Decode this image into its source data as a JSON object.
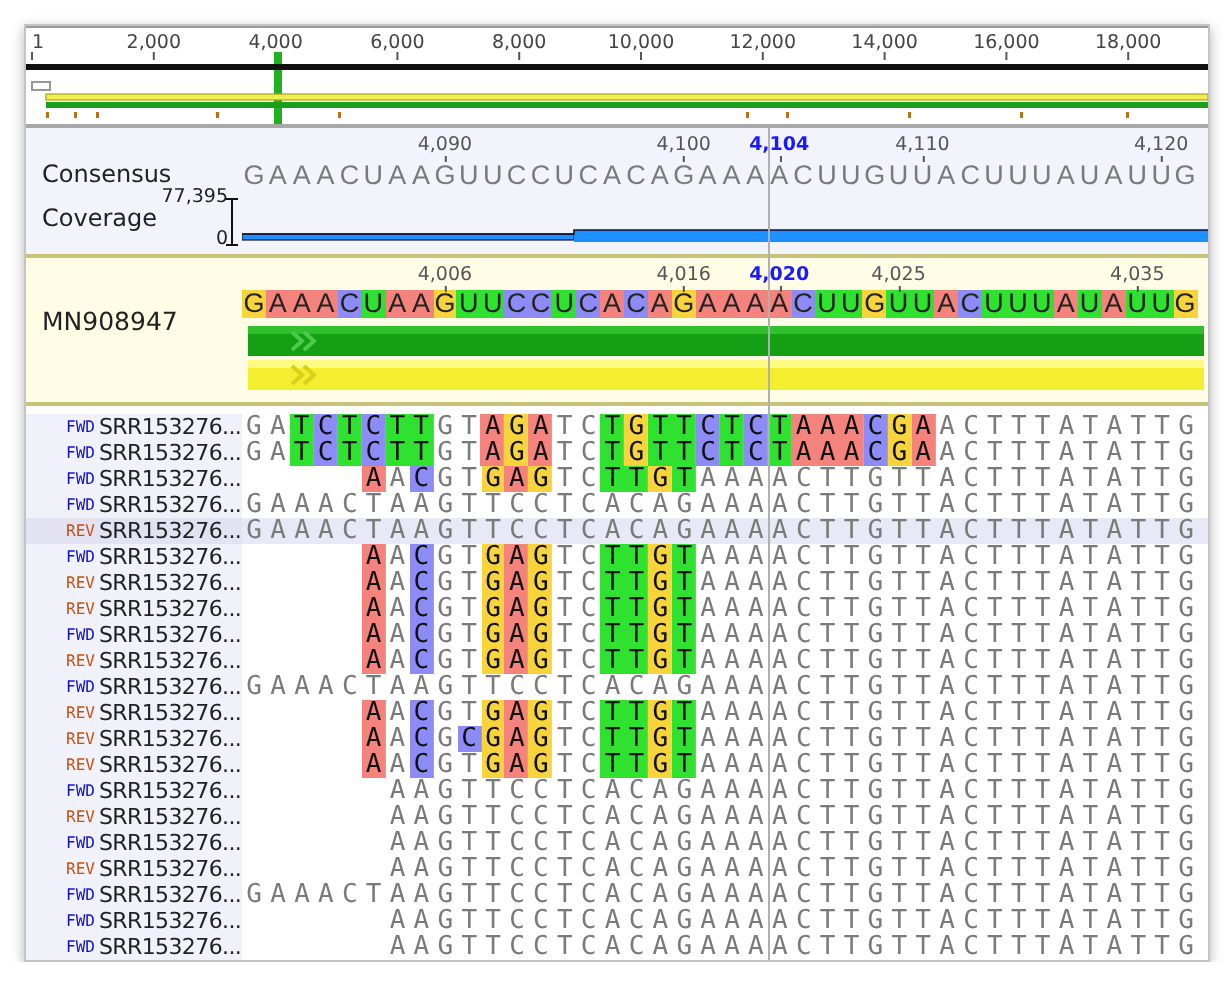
{
  "overview": {
    "ticks": [
      "1",
      "2,000",
      "4,000",
      "6,000",
      "8,000",
      "10,000",
      "12,000",
      "14,000",
      "16,000",
      "18,000"
    ]
  },
  "consensus": {
    "label": "Consensus",
    "columns": [
      {
        "base": "G"
      },
      {
        "base": "A"
      },
      {
        "base": "A"
      },
      {
        "base": "A"
      },
      {
        "base": "C"
      },
      {
        "base": "U"
      },
      {
        "base": "A"
      },
      {
        "base": "A"
      },
      {
        "base": "G",
        "tick": "4,090",
        "current": false
      },
      {
        "base": "U"
      },
      {
        "base": "U"
      },
      {
        "base": "C"
      },
      {
        "base": "C"
      },
      {
        "base": "U"
      },
      {
        "base": "C"
      },
      {
        "base": "A"
      },
      {
        "base": "C"
      },
      {
        "base": "A"
      },
      {
        "base": "G",
        "tick": "4,100",
        "current": false
      },
      {
        "base": "A"
      },
      {
        "base": "A"
      },
      {
        "base": "A"
      },
      {
        "base": "A",
        "tick": "4,104",
        "current": true
      },
      {
        "base": "C"
      },
      {
        "base": "U"
      },
      {
        "base": "U"
      },
      {
        "base": "G"
      },
      {
        "base": "U"
      },
      {
        "base": "U",
        "tick": "4,110",
        "current": false
      },
      {
        "base": "A"
      },
      {
        "base": "C"
      },
      {
        "base": "U"
      },
      {
        "base": "U"
      },
      {
        "base": "U"
      },
      {
        "base": "A"
      },
      {
        "base": "U"
      },
      {
        "base": "A"
      },
      {
        "base": "U"
      },
      {
        "base": "U",
        "tick": "4,120",
        "current": false
      },
      {
        "base": "G"
      }
    ]
  },
  "coverage": {
    "label": "Coverage",
    "max": "77,395",
    "min": "0"
  },
  "reference": {
    "name": "MN908947",
    "columns": [
      {
        "base": "G",
        "color": "#f7d33c"
      },
      {
        "base": "A",
        "color": "#f4837d"
      },
      {
        "base": "A",
        "color": "#f4837d"
      },
      {
        "base": "A",
        "color": "#f4837d"
      },
      {
        "base": "C",
        "color": "#8d8cf7"
      },
      {
        "base": "U",
        "color": "#2fe22f"
      },
      {
        "base": "A",
        "color": "#f4837d"
      },
      {
        "base": "A",
        "color": "#f4837d"
      },
      {
        "base": "G",
        "color": "#f7d33c",
        "tick": "4,006",
        "current": false
      },
      {
        "base": "U",
        "color": "#2fe22f"
      },
      {
        "base": "U",
        "color": "#2fe22f"
      },
      {
        "base": "C",
        "color": "#8d8cf7"
      },
      {
        "base": "C",
        "color": "#8d8cf7"
      },
      {
        "base": "U",
        "color": "#2fe22f"
      },
      {
        "base": "C",
        "color": "#8d8cf7"
      },
      {
        "base": "A",
        "color": "#f4837d"
      },
      {
        "base": "C",
        "color": "#8d8cf7"
      },
      {
        "base": "A",
        "color": "#f4837d"
      },
      {
        "base": "G",
        "color": "#f7d33c",
        "tick": "4,016",
        "current": false
      },
      {
        "base": "A",
        "color": "#f4837d"
      },
      {
        "base": "A",
        "color": "#f4837d"
      },
      {
        "base": "A",
        "color": "#f4837d"
      },
      {
        "base": "A",
        "color": "#f4837d",
        "tick": "4,020",
        "current": true
      },
      {
        "base": "C",
        "color": "#8d8cf7"
      },
      {
        "base": "U",
        "color": "#2fe22f"
      },
      {
        "base": "U",
        "color": "#2fe22f"
      },
      {
        "base": "G",
        "color": "#f7d33c"
      },
      {
        "base": "U",
        "color": "#2fe22f",
        "tick": "4,025",
        "current": false
      },
      {
        "base": "U",
        "color": "#2fe22f"
      },
      {
        "base": "A",
        "color": "#f4837d"
      },
      {
        "base": "C",
        "color": "#8d8cf7"
      },
      {
        "base": "U",
        "color": "#2fe22f"
      },
      {
        "base": "U",
        "color": "#2fe22f"
      },
      {
        "base": "U",
        "color": "#2fe22f"
      },
      {
        "base": "A",
        "color": "#f4837d"
      },
      {
        "base": "U",
        "color": "#2fe22f"
      },
      {
        "base": "A",
        "color": "#f4837d"
      },
      {
        "base": "U",
        "color": "#2fe22f",
        "tick": "4,035",
        "current": false
      },
      {
        "base": "U",
        "color": "#2fe22f"
      },
      {
        "base": "G",
        "color": "#f7d33c"
      }
    ]
  },
  "reads": [
    {
      "strand": "FWD",
      "kind": "fwd",
      "name": "SRR153276...",
      "selected": false,
      "runs": [
        {
          "text": "GA"
        },
        {
          "text": "T",
          "color": "#2fe22f"
        },
        {
          "text": "C",
          "color": "#8d8cf7"
        },
        {
          "text": "T",
          "color": "#2fe22f"
        },
        {
          "text": "C",
          "color": "#8d8cf7"
        },
        {
          "text": "TT",
          "color": "#2fe22f"
        },
        {
          "text": "GT"
        },
        {
          "text": "A",
          "color": "#f4837d"
        },
        {
          "text": "G",
          "color": "#f7d33c"
        },
        {
          "text": "A",
          "color": "#f4837d"
        },
        {
          "text": "TC"
        },
        {
          "text": "T",
          "color": "#2fe22f"
        },
        {
          "text": "G",
          "color": "#f7d33c"
        },
        {
          "text": "TT",
          "color": "#2fe22f"
        },
        {
          "text": "C",
          "color": "#8d8cf7"
        },
        {
          "text": "T",
          "color": "#2fe22f"
        },
        {
          "text": "C",
          "color": "#8d8cf7"
        },
        {
          "text": "T",
          "color": "#2fe22f"
        },
        {
          "text": "AAA",
          "color": "#f4837d"
        },
        {
          "text": "C",
          "color": "#8d8cf7"
        },
        {
          "text": "G",
          "color": "#f7d33c"
        },
        {
          "text": "A",
          "color": "#f4837d"
        },
        {
          "text": "ACTTTATATTG"
        }
      ]
    },
    {
      "strand": "FWD",
      "kind": "fwd",
      "name": "SRR153276...",
      "selected": false,
      "runs": [
        {
          "text": "GA"
        },
        {
          "text": "T",
          "color": "#2fe22f"
        },
        {
          "text": "C",
          "color": "#8d8cf7"
        },
        {
          "text": "T",
          "color": "#2fe22f"
        },
        {
          "text": "C",
          "color": "#8d8cf7"
        },
        {
          "text": "TT",
          "color": "#2fe22f"
        },
        {
          "text": "GT"
        },
        {
          "text": "A",
          "color": "#f4837d"
        },
        {
          "text": "G",
          "color": "#f7d33c"
        },
        {
          "text": "A",
          "color": "#f4837d"
        },
        {
          "text": "TC"
        },
        {
          "text": "T",
          "color": "#2fe22f"
        },
        {
          "text": "G",
          "color": "#f7d33c"
        },
        {
          "text": "TT",
          "color": "#2fe22f"
        },
        {
          "text": "C",
          "color": "#8d8cf7"
        },
        {
          "text": "T",
          "color": "#2fe22f"
        },
        {
          "text": "C",
          "color": "#8d8cf7"
        },
        {
          "text": "T",
          "color": "#2fe22f"
        },
        {
          "text": "AAA",
          "color": "#f4837d"
        },
        {
          "text": "C",
          "color": "#8d8cf7"
        },
        {
          "text": "G",
          "color": "#f7d33c"
        },
        {
          "text": "A",
          "color": "#f4837d"
        },
        {
          "text": "ACTTTATATTG"
        }
      ]
    },
    {
      "strand": "FWD",
      "kind": "fwd",
      "name": "SRR153276...",
      "selected": false,
      "runs": [
        {
          "text": "A",
          "color": "#f4837d"
        },
        {
          "text": "A"
        },
        {
          "text": "C",
          "color": "#8d8cf7"
        },
        {
          "text": "GT"
        },
        {
          "text": "G",
          "color": "#f7d33c"
        },
        {
          "text": "A",
          "color": "#f4837d"
        },
        {
          "text": "G",
          "color": "#f7d33c"
        },
        {
          "text": "TC"
        },
        {
          "text": "TT",
          "color": "#2fe22f"
        },
        {
          "text": "G",
          "color": "#f7d33c"
        },
        {
          "text": "T",
          "color": "#2fe22f"
        },
        {
          "text": "AAAACTTGTTACTTTATATTG"
        }
      ]
    },
    {
      "strand": "FWD",
      "kind": "fwd",
      "name": "SRR153276...",
      "selected": false,
      "runs": [
        {
          "text": "GAAACTAAGTTCCTCACAGAAAACTTGTTACTTTATATTG"
        }
      ]
    },
    {
      "strand": "REV",
      "kind": "rev",
      "name": "SRR153276...",
      "selected": true,
      "runs": [
        {
          "text": "GAAACTAAGTTCCTCACAGAAAACTTGTTACTTTATATTG"
        }
      ]
    },
    {
      "strand": "FWD",
      "kind": "fwd",
      "name": "SRR153276...",
      "selected": false,
      "runs": [
        {
          "text": "A",
          "color": "#f4837d"
        },
        {
          "text": "A"
        },
        {
          "text": "C",
          "color": "#8d8cf7"
        },
        {
          "text": "GT"
        },
        {
          "text": "G",
          "color": "#f7d33c"
        },
        {
          "text": "A",
          "color": "#f4837d"
        },
        {
          "text": "G",
          "color": "#f7d33c"
        },
        {
          "text": "TC"
        },
        {
          "text": "TT",
          "color": "#2fe22f"
        },
        {
          "text": "G",
          "color": "#f7d33c"
        },
        {
          "text": "T",
          "color": "#2fe22f"
        },
        {
          "text": "AAAACTTGTTACTTTATATTG"
        }
      ]
    },
    {
      "strand": "REV",
      "kind": "rev",
      "name": "SRR153276...",
      "selected": false,
      "runs": [
        {
          "text": "A",
          "color": "#f4837d"
        },
        {
          "text": "A"
        },
        {
          "text": "C",
          "color": "#8d8cf7"
        },
        {
          "text": "GT"
        },
        {
          "text": "G",
          "color": "#f7d33c"
        },
        {
          "text": "A",
          "color": "#f4837d"
        },
        {
          "text": "G",
          "color": "#f7d33c"
        },
        {
          "text": "TC"
        },
        {
          "text": "TT",
          "color": "#2fe22f"
        },
        {
          "text": "G",
          "color": "#f7d33c"
        },
        {
          "text": "T",
          "color": "#2fe22f"
        },
        {
          "text": "AAAACTTGTTACTTTATATTG"
        }
      ]
    },
    {
      "strand": "REV",
      "kind": "rev",
      "name": "SRR153276...",
      "selected": false,
      "runs": [
        {
          "text": "A",
          "color": "#f4837d"
        },
        {
          "text": "A"
        },
        {
          "text": "C",
          "color": "#8d8cf7"
        },
        {
          "text": "GT"
        },
        {
          "text": "G",
          "color": "#f7d33c"
        },
        {
          "text": "A",
          "color": "#f4837d"
        },
        {
          "text": "G",
          "color": "#f7d33c"
        },
        {
          "text": "TC"
        },
        {
          "text": "TT",
          "color": "#2fe22f"
        },
        {
          "text": "G",
          "color": "#f7d33c"
        },
        {
          "text": "T",
          "color": "#2fe22f"
        },
        {
          "text": "AAAACTTGTTACTTTATATTG"
        }
      ]
    },
    {
      "strand": "FWD",
      "kind": "fwd",
      "name": "SRR153276...",
      "selected": false,
      "runs": [
        {
          "text": "A",
          "color": "#f4837d"
        },
        {
          "text": "A"
        },
        {
          "text": "C",
          "color": "#8d8cf7"
        },
        {
          "text": "GT"
        },
        {
          "text": "G",
          "color": "#f7d33c"
        },
        {
          "text": "A",
          "color": "#f4837d"
        },
        {
          "text": "G",
          "color": "#f7d33c"
        },
        {
          "text": "TC"
        },
        {
          "text": "TT",
          "color": "#2fe22f"
        },
        {
          "text": "G",
          "color": "#f7d33c"
        },
        {
          "text": "T",
          "color": "#2fe22f"
        },
        {
          "text": "AAAACTTGTTACTTTATATTG"
        }
      ]
    },
    {
      "strand": "REV",
      "kind": "rev",
      "name": "SRR153276...",
      "selected": false,
      "runs": [
        {
          "text": "A",
          "color": "#f4837d"
        },
        {
          "text": "A"
        },
        {
          "text": "C",
          "color": "#8d8cf7"
        },
        {
          "text": "GT"
        },
        {
          "text": "G",
          "color": "#f7d33c"
        },
        {
          "text": "A",
          "color": "#f4837d"
        },
        {
          "text": "G",
          "color": "#f7d33c"
        },
        {
          "text": "TC"
        },
        {
          "text": "TT",
          "color": "#2fe22f"
        },
        {
          "text": "G",
          "color": "#f7d33c"
        },
        {
          "text": "T",
          "color": "#2fe22f"
        },
        {
          "text": "AAAACTTGTTACTTTATATTG"
        }
      ]
    },
    {
      "strand": "FWD",
      "kind": "fwd",
      "name": "SRR153276...",
      "selected": false,
      "runs": [
        {
          "text": "GAAACTAAGTTCCTCACAGAAAACTTGTTACTTTATATTG"
        }
      ]
    },
    {
      "strand": "REV",
      "kind": "rev",
      "name": "SRR153276...",
      "selected": false,
      "runs": [
        {
          "text": "A",
          "color": "#f4837d"
        },
        {
          "text": "A"
        },
        {
          "text": "C",
          "color": "#8d8cf7"
        },
        {
          "text": "GT"
        },
        {
          "text": "G",
          "color": "#f7d33c"
        },
        {
          "text": "A",
          "color": "#f4837d"
        },
        {
          "text": "G",
          "color": "#f7d33c"
        },
        {
          "text": "TC"
        },
        {
          "text": "TT",
          "color": "#2fe22f"
        },
        {
          "text": "G",
          "color": "#f7d33c"
        },
        {
          "text": "T",
          "color": "#2fe22f"
        },
        {
          "text": "AAAACTTGTTACTTTATATTG"
        }
      ]
    },
    {
      "strand": "REV",
      "kind": "rev",
      "name": "SRR153276...",
      "selected": false,
      "runs": [
        {
          "text": "A",
          "color": "#f4837d"
        },
        {
          "text": "A"
        },
        {
          "text": "C",
          "color": "#8d8cf7"
        },
        {
          "text": "G"
        },
        {
          "text": "C",
          "color": "#8d8cf7"
        },
        {
          "text": "G",
          "color": "#f7d33c"
        },
        {
          "text": "A",
          "color": "#f4837d"
        },
        {
          "text": "G",
          "color": "#f7d33c"
        },
        {
          "text": "TC"
        },
        {
          "text": "TT",
          "color": "#2fe22f"
        },
        {
          "text": "G",
          "color": "#f7d33c"
        },
        {
          "text": "T",
          "color": "#2fe22f"
        },
        {
          "text": "AAAACTTGTTACTTTATATTG"
        }
      ]
    },
    {
      "strand": "REV",
      "kind": "rev",
      "name": "SRR153276...",
      "selected": false,
      "runs": [
        {
          "text": "A",
          "color": "#f4837d"
        },
        {
          "text": "A"
        },
        {
          "text": "C",
          "color": "#8d8cf7"
        },
        {
          "text": "GT"
        },
        {
          "text": "G",
          "color": "#f7d33c"
        },
        {
          "text": "A",
          "color": "#f4837d"
        },
        {
          "text": "G",
          "color": "#f7d33c"
        },
        {
          "text": "TC"
        },
        {
          "text": "TT",
          "color": "#2fe22f"
        },
        {
          "text": "G",
          "color": "#f7d33c"
        },
        {
          "text": "T",
          "color": "#2fe22f"
        },
        {
          "text": "AAAACTTGTTACTTTATATTG"
        }
      ]
    },
    {
      "strand": "FWD",
      "kind": "fwd",
      "name": "SRR153276...",
      "selected": false,
      "runs": [
        {
          "text": "AAGTTCCTCACAGAAAACTTGTTACTTTATATTG"
        }
      ]
    },
    {
      "strand": "REV",
      "kind": "rev",
      "name": "SRR153276...",
      "selected": false,
      "runs": [
        {
          "text": "AAGTTCCTCACAGAAAACTTGTTACTTTATATTG"
        }
      ]
    },
    {
      "strand": "FWD",
      "kind": "fwd",
      "name": "SRR153276...",
      "selected": false,
      "runs": [
        {
          "text": "AAGTTCCTCACAGAAAACTTGTTACTTTATATTG"
        }
      ]
    },
    {
      "strand": "REV",
      "kind": "rev",
      "name": "SRR153276...",
      "selected": false,
      "runs": [
        {
          "text": "AAGTTCCTCACAGAAAACTTGTTACTTTATATTG"
        }
      ]
    },
    {
      "strand": "FWD",
      "kind": "fwd",
      "name": "SRR153276...",
      "selected": false,
      "runs": [
        {
          "text": "GAAACTAAGTTCCTCACAGAAAACTTGTTACTTTATATTG"
        }
      ]
    },
    {
      "strand": "FWD",
      "kind": "fwd",
      "name": "SRR153276...",
      "selected": false,
      "runs": [
        {
          "text": "AAGTTCCTCACAGAAAACTTGTTACTTTATATTG"
        }
      ]
    },
    {
      "strand": "FWD",
      "kind": "fwd",
      "name": "SRR153276...",
      "selected": false,
      "runs": [
        {
          "text": "AAGTTCCTCACAGAAAACTTGTTACTTTATATTG"
        }
      ]
    }
  ]
}
